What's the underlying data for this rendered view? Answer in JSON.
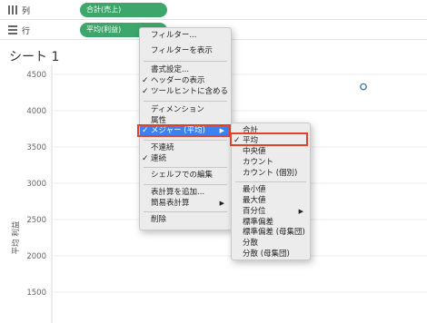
{
  "shelves": {
    "columns": {
      "label": "列",
      "pill": "合計(売上)"
    },
    "rows": {
      "label": "行",
      "pill": "平均(利益)"
    }
  },
  "sheet": {
    "title": "シート 1"
  },
  "chart_data": {
    "type": "scatter",
    "ylabel": "平均 利益",
    "yticks": [
      4500,
      4000,
      3500,
      3000,
      2500,
      2000,
      1500
    ],
    "ylim": [
      1250,
      4650
    ],
    "points": [
      {
        "y": 4330
      }
    ],
    "point_color": "#4e79a7"
  },
  "context_menu": {
    "items": {
      "filter": "フィルター...",
      "show_filter": "フィルターを表示",
      "format": "書式設定...",
      "show_header": "ヘッダーの表示",
      "include_tooltip": "ツールヒントに含める",
      "dimension": "ディメンション",
      "attribute": "属性",
      "measure": "メジャー (平均)",
      "discrete": "不連続",
      "continuous": "連続",
      "edit_shelf": "シェルフでの編集",
      "add_table_calc": "表計算を追加...",
      "quick_table_calc": "簡易表計算",
      "remove": "削除"
    }
  },
  "submenu": {
    "items": {
      "sum": "合計",
      "average": "平均",
      "median": "中央値",
      "count": "カウント",
      "count_distinct": "カウント (個別)",
      "minimum": "最小値",
      "maximum": "最大値",
      "percentile": "百分位",
      "std_dev": "標準偏差",
      "std_dev_pop": "標準偏差 (母集団)",
      "variance": "分散",
      "variance_pop": "分散 (母集団)"
    }
  }
}
